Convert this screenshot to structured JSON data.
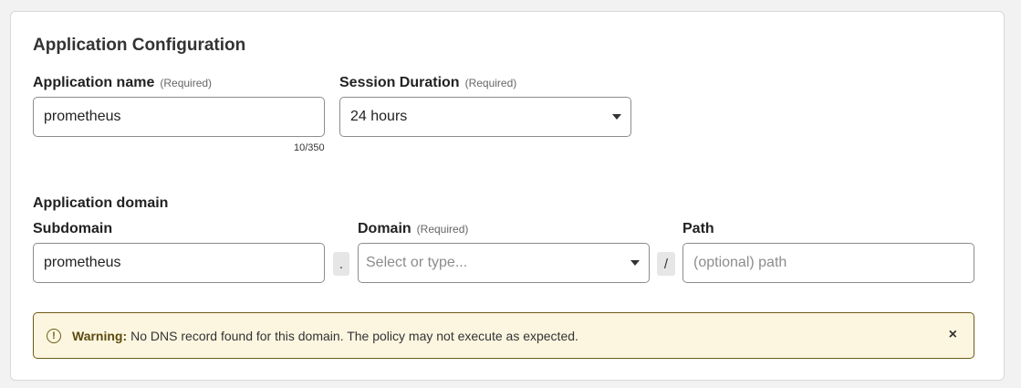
{
  "title": "Application Configuration",
  "app_name": {
    "label": "Application name",
    "required": "(Required)",
    "value": "prometheus",
    "counter": "10/350"
  },
  "session": {
    "label": "Session Duration",
    "required": "(Required)",
    "value": "24 hours"
  },
  "domain_section": {
    "label": "Application domain",
    "subdomain": {
      "label": "Subdomain",
      "value": "prometheus"
    },
    "dot": ".",
    "domain": {
      "label": "Domain",
      "required": "(Required)",
      "placeholder": "Select or type..."
    },
    "slash": "/",
    "path": {
      "label": "Path",
      "placeholder": "(optional) path"
    }
  },
  "warning": {
    "icon": "!",
    "bold": "Warning:",
    "message": "No DNS record found for this domain. The policy may not execute as expected.",
    "close": "×"
  },
  "colors": {
    "warning_bg": "#fcf6e0",
    "warning_border": "#6d5b17"
  }
}
